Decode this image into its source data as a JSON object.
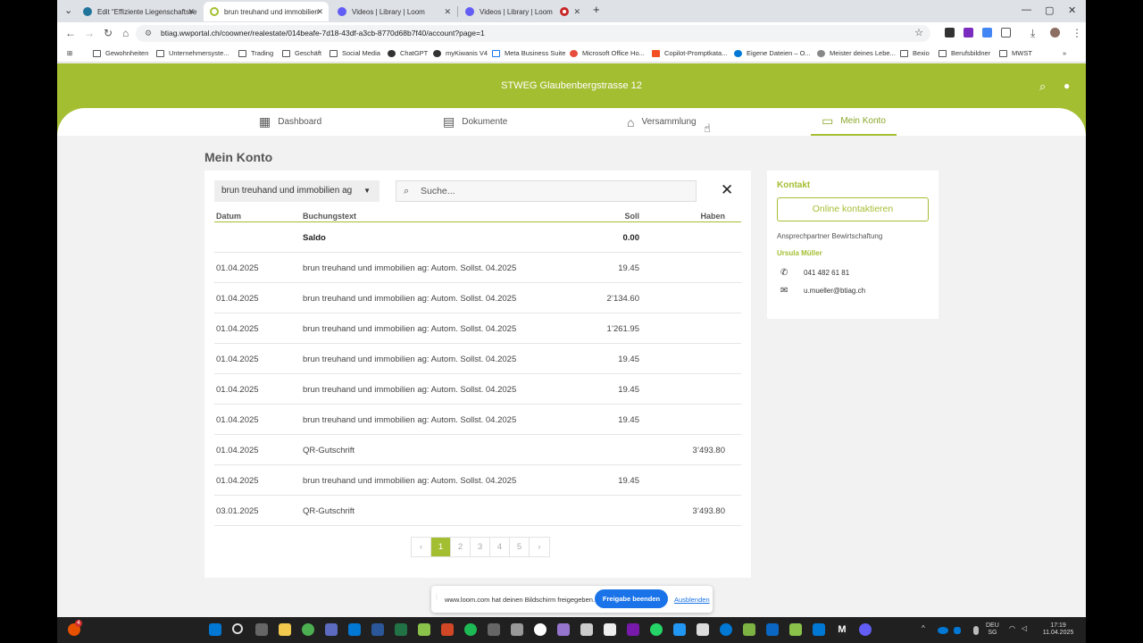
{
  "browser": {
    "tabs": [
      {
        "title": "Edit “Effiziente Liegenschaftsve",
        "active": false
      },
      {
        "title": "brun treuhand und immobilien",
        "active": true
      },
      {
        "title": "Videos | Library | Loom",
        "active": false
      },
      {
        "title": "Videos | Library | Loom",
        "active": false
      },
      {
        "title": "",
        "active": false
      }
    ],
    "new_tab": "+",
    "url": "btiag.wwportal.ch/coowner/realestate/014beafe-7d18-43df-a3cb-8770d68b7f40/account?page=1",
    "bookmarks": [
      "Gewohnheiten",
      "Unternehmersyste...",
      "Trading",
      "Geschäft",
      "Social Media",
      "ChatGPT",
      "myKiwanis V4",
      "Meta Business Suite",
      "Microsoft Office Ho...",
      "Copilot-Promptkata...",
      "Eigene Dateien – O...",
      "Meister deines Lebe...",
      "Bexio",
      "Berufsbildner",
      "MWST"
    ]
  },
  "site": {
    "title": "STWEG Glaubenbergstrasse 12",
    "nav": [
      {
        "label": "Dashboard",
        "icon": "dashboard-icon"
      },
      {
        "label": "Dokumente",
        "icon": "document-icon"
      },
      {
        "label": "Versammlung",
        "icon": "assembly-icon"
      },
      {
        "label": "Mein Konto",
        "icon": "account-icon",
        "active": true
      }
    ]
  },
  "account": {
    "page_title": "Mein Konto",
    "filter_value": "brun treuhand und immobilien ag",
    "search_placeholder": "Suche...",
    "columns": {
      "date": "Datum",
      "text": "Buchungstext",
      "soll": "Soll",
      "haben": "Haben"
    },
    "rows": [
      {
        "date": "",
        "text": "Saldo",
        "soll": "0.00",
        "haben": "",
        "bold": true
      },
      {
        "date": "01.04.2025",
        "text": "brun treuhand und immobilien ag: Autom. Sollst. 04.2025",
        "soll": "19.45",
        "haben": ""
      },
      {
        "date": "01.04.2025",
        "text": "brun treuhand und immobilien ag: Autom. Sollst. 04.2025",
        "soll": "2’134.60",
        "haben": ""
      },
      {
        "date": "01.04.2025",
        "text": "brun treuhand und immobilien ag: Autom. Sollst. 04.2025",
        "soll": "1’261.95",
        "haben": ""
      },
      {
        "date": "01.04.2025",
        "text": "brun treuhand und immobilien ag: Autom. Sollst. 04.2025",
        "soll": "19.45",
        "haben": ""
      },
      {
        "date": "01.04.2025",
        "text": "brun treuhand und immobilien ag: Autom. Sollst. 04.2025",
        "soll": "19.45",
        "haben": ""
      },
      {
        "date": "01.04.2025",
        "text": "brun treuhand und immobilien ag: Autom. Sollst. 04.2025",
        "soll": "19.45",
        "haben": ""
      },
      {
        "date": "01.04.2025",
        "text": "QR-Gutschrift",
        "soll": "",
        "haben": "3’493.80"
      },
      {
        "date": "01.04.2025",
        "text": "brun treuhand und immobilien ag: Autom. Sollst. 04.2025",
        "soll": "19.45",
        "haben": ""
      },
      {
        "date": "03.01.2025",
        "text": "QR-Gutschrift",
        "soll": "",
        "haben": "3’493.80"
      }
    ],
    "pagination": {
      "prev": "‹",
      "pages": [
        "1",
        "2",
        "3",
        "4",
        "5"
      ],
      "current": "1",
      "next": "›"
    }
  },
  "contact": {
    "title": "Kontakt",
    "button": "Online kontaktieren",
    "role": "Ansprechpartner Bewirtschaftung",
    "name": "Ursula Müller",
    "phone": "041 482 61 81",
    "email": "u.mueller@btiag.ch"
  },
  "loom": {
    "message": "www.loom.com hat deinen Bildschirm freigegeben.",
    "stop": "Freigabe beenden",
    "hide": "Ausblenden"
  },
  "taskbar": {
    "lang_line1": "DEU",
    "lang_line2": "SG",
    "time": "17:19",
    "date": "11.04.2025",
    "badge": "4"
  },
  "colors": {
    "brand": "#a4be32",
    "loom_button": "#1a73e8"
  }
}
